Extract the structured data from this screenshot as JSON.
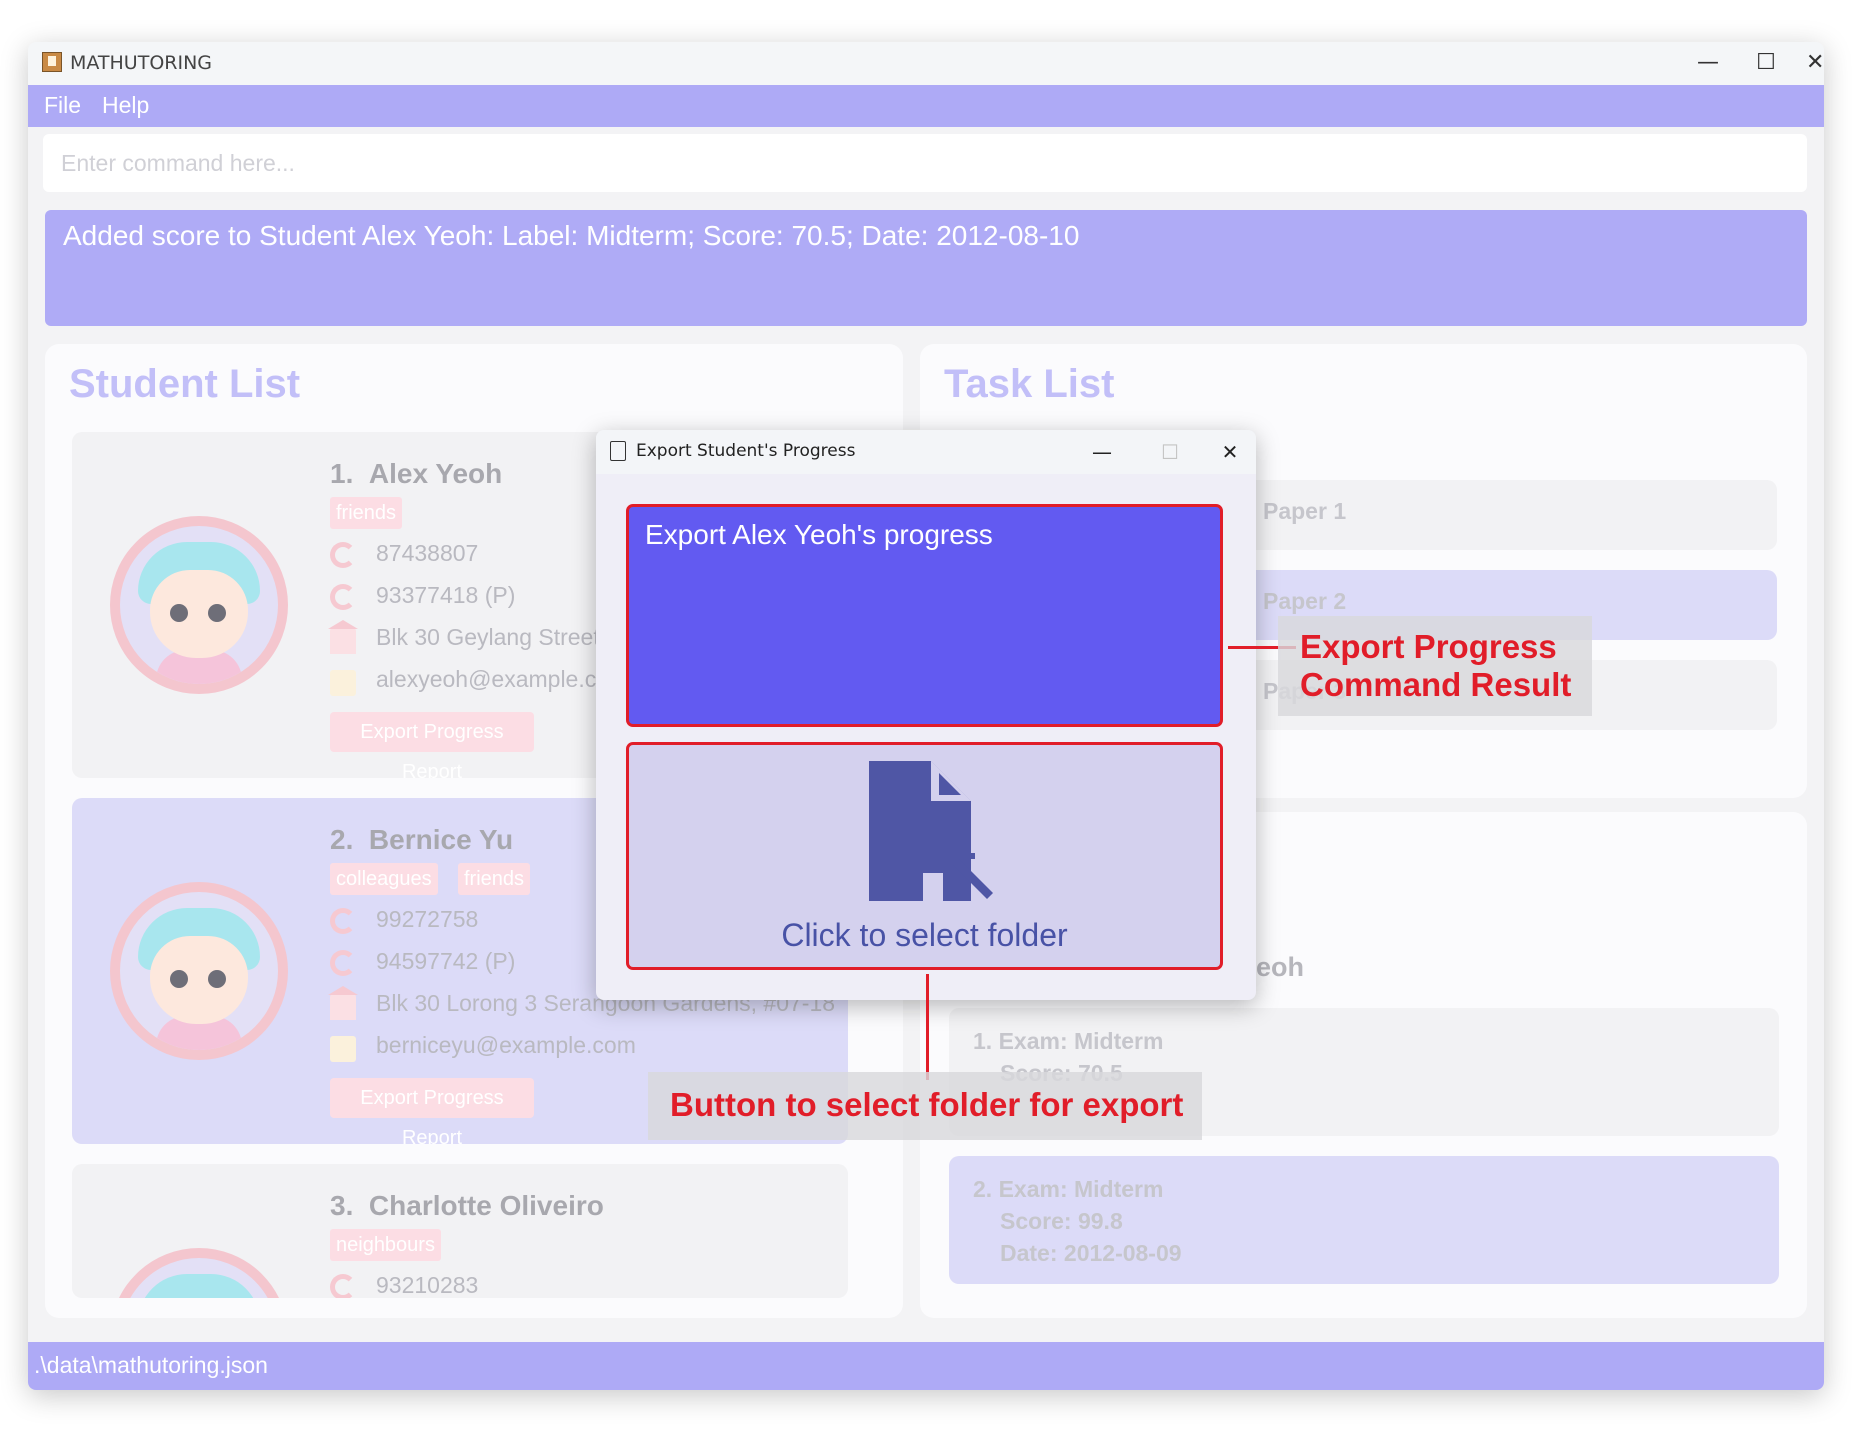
{
  "window": {
    "title": "MATHUTORING",
    "controls": {
      "minimize": "—",
      "maximize": "☐",
      "close": "✕"
    }
  },
  "menu": {
    "file": "File",
    "help": "Help"
  },
  "command": {
    "placeholder": "Enter command here..."
  },
  "result": {
    "text": "Added score to Student Alex Yeoh: Label: Midterm; Score: 70.5; Date: 2012-08-10"
  },
  "student_list": {
    "title": "Student List",
    "export_label": "Export Progress Report",
    "students": [
      {
        "index": "1.",
        "name": "Alex Yeoh",
        "tags": [
          "friends"
        ],
        "phone": "87438807",
        "parent_phone": "93377418 (P)",
        "address": "Blk 30 Geylang Street",
        "email": "alexyeoh@example.co"
      },
      {
        "index": "2.",
        "name": "Bernice Yu",
        "tags": [
          "colleagues",
          "friends"
        ],
        "phone": "99272758",
        "parent_phone": "94597742 (P)",
        "address": "Blk 30 Lorong 3 Serangoon Gardens, #07-18",
        "email": "berniceyu@example.com"
      },
      {
        "index": "3.",
        "name": "Charlotte Oliveiro",
        "tags": [
          "neighbours"
        ],
        "phone": "93210283"
      }
    ]
  },
  "task_list": {
    "title": "Task List",
    "tasks": [
      "Paper 1",
      "Paper 2",
      "Paper 3"
    ]
  },
  "scores": {
    "header_fragment": "eoh",
    "items": [
      {
        "exam": "1. Exam: Midterm",
        "score": "Score: 70.5"
      },
      {
        "exam": "2. Exam: Midterm",
        "score": "Score: 99.8",
        "date": "Date: 2012-08-09"
      }
    ]
  },
  "status": {
    "path": ".\\data\\mathutoring.json"
  },
  "dialog": {
    "title": "Export Student's Progress",
    "controls": {
      "minimize": "—",
      "maximize": "☐",
      "close": "✕"
    },
    "result_text": "Export Alex Yeoh's progress",
    "folder_label": "Click to select folder",
    "icon": "file-export-icon"
  },
  "annotations": {
    "result_line1": "Export Progress",
    "result_line2": "Command Result",
    "button": "Button to select folder for export"
  },
  "colors": {
    "accent": "#aeaaf6",
    "dialog_result": "#625af1",
    "annotation": "#e11d29"
  }
}
